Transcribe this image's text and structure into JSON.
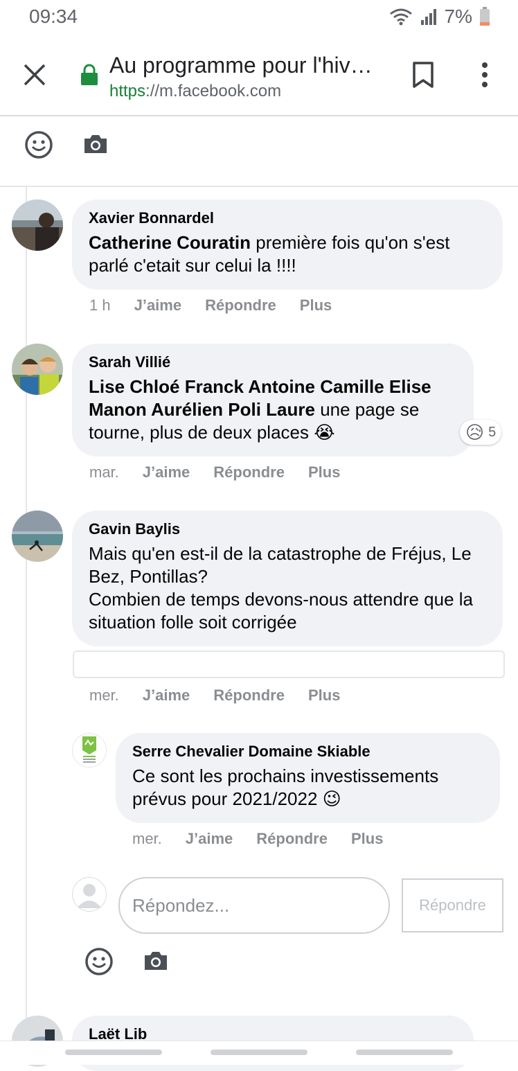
{
  "status_bar": {
    "time": "09:34",
    "battery": "7%"
  },
  "browser": {
    "title": "Au programme pour l'hiv…",
    "url_scheme": "https",
    "url_rest": "://m.facebook.com"
  },
  "comments": [
    {
      "author": "Xavier Bonnardel",
      "mention": "Catherine Couratin",
      "text": " première fois qu'on s'est parlé c'etait sur celui la !!!!",
      "time": "1 h",
      "like": "J’aime",
      "reply": "Répondre",
      "more": "Plus"
    },
    {
      "author": "Sarah Villié",
      "mention": "Lise Chloé Franck Antoine Camille Elise Manon Aurélien Poli Laure",
      "text": " une page se tourne, plus de deux places 😭",
      "time": "mar.",
      "like": "J’aime",
      "reply": "Répondre",
      "more": "Plus",
      "reaction_emoji": "😥",
      "reaction_count": "5"
    },
    {
      "author": "Gavin Baylis",
      "line1": "Mais qu'en est-il de la catastrophe de Fréjus, Le Bez, Pontillas?",
      "line2": "Combien de temps devons-nous attendre que la situation folle soit corrigée",
      "time": "mer.",
      "like": "J’aime",
      "reply": "Répondre",
      "more": "Plus"
    }
  ],
  "reply": {
    "author": "Serre Chevalier Domaine Skiable",
    "text": "Ce sont les prochains investissements prévus pour 2021/2022 😉",
    "time": "mer.",
    "like": "J’aime",
    "reply": "Répondre",
    "more": "Plus"
  },
  "reply_box": {
    "placeholder": "Répondez...",
    "button": "Répondre"
  },
  "next_comment": {
    "author": "Laët Lib"
  },
  "colors": {
    "lock": "#1e8e3e",
    "bubble": "#f0f2f5",
    "action": "#8a8d91"
  }
}
